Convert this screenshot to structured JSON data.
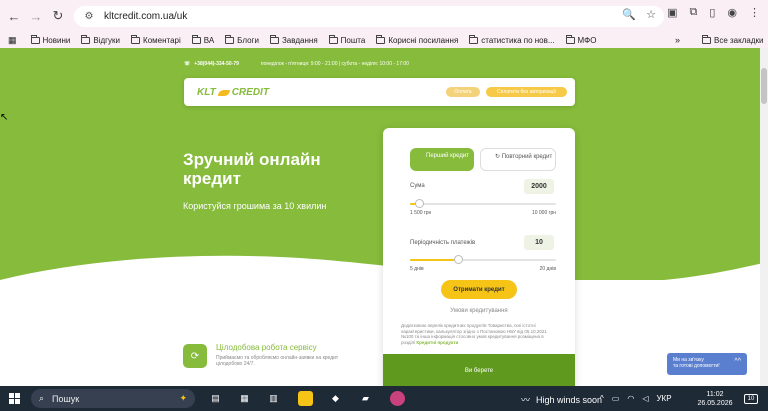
{
  "browser": {
    "url": "kltcredit.com.ua/uk",
    "bookmarks": [
      "Новини",
      "Відгуки",
      "Коментарі",
      "ВА",
      "Блоги",
      "Завдання",
      "Пошта",
      "Корисні посилання",
      "статистика по нов...",
      "МФО"
    ],
    "all_bookmarks": "Все закладки",
    "more": "»"
  },
  "site": {
    "phone": "+38(044)-334-50-79",
    "hours": "понеділок - п'ятниця: 9:00 - 21:00 | субота - неділя: 10:00 - 17:00",
    "logo_text": "KLT",
    "logo_text2": "CREDIT",
    "pay_label": "Оплата",
    "pay_cabinet_label": "Сплатити без авторизації",
    "hero_title": "Зручний онлайн кредит",
    "hero_sub": "Користуйся грошима за 10 хвилин",
    "feature_title": "Цілодобова робота сервісу",
    "feature_text": "Приймаємо та обробляємо онлайн-заявки на кредит цілодобово 24/7."
  },
  "calculator": {
    "tab_first": "Перший кредит",
    "tab_repeat": "↻ Повторний кредит",
    "sum_label": "Сума",
    "sum_value": "2000",
    "sum_min": "1 500 грн",
    "sum_max": "10 000 грн",
    "sum_fraction": 0.06,
    "period_label": "Періодичність платежів",
    "period_value": "10",
    "period_min": "5 днів",
    "period_max": "20 днів",
    "period_fraction": 0.33,
    "get_button": "Отримати кредит",
    "terms_link": "Умови кредитування",
    "note_text": "Додатковою перелік кредитних продуктів Товариства, їхні істотні характеристики, калькулятор згідно з Постановою НБУ від 05.10.2021 №100 та інша інформація стосовно умов кредитування розміщена в розділі ",
    "note_link": "Кредитні продукти",
    "footer_title": "Ви берете",
    "accent": "#86bb3b",
    "button_color": "#f5c417"
  },
  "chat": {
    "line1": "Ми на зв'язку",
    "line2": "та готові допомогти!",
    "icon": "^^"
  },
  "taskbar": {
    "search_placeholder": "Пошук",
    "weather": "High winds soon",
    "lang": "УКР",
    "time": "11:02",
    "date": "26.05.2026",
    "notifications": "10"
  }
}
